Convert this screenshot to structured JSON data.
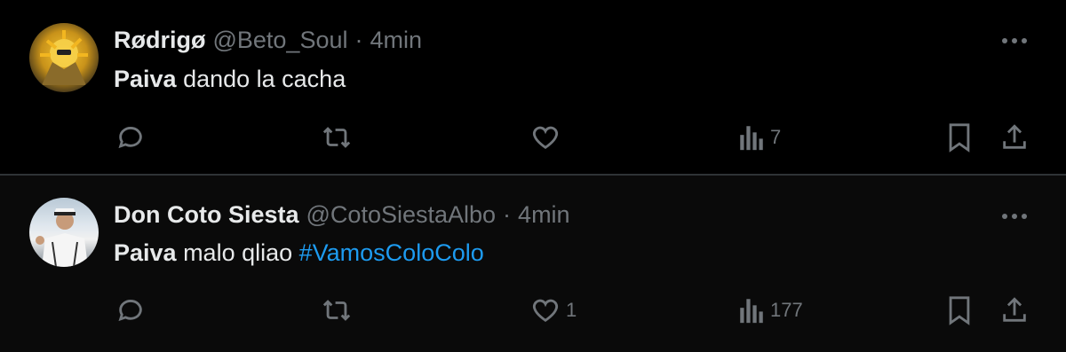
{
  "tweets": [
    {
      "display_name": "Rødrigø",
      "handle": "@Beto_Soul",
      "separator": "·",
      "time": "4min",
      "text_bold": "Paiva",
      "text_rest": " dando la cacha",
      "hashtag": "",
      "reply_count": "",
      "retweet_count": "",
      "like_count": "",
      "view_count": "7"
    },
    {
      "display_name": "Don Coto Siesta",
      "handle": "@CotoSiestaAlbo",
      "separator": "·",
      "time": "4min",
      "text_bold": "Paiva",
      "text_rest": " malo qliao ",
      "hashtag": "#VamosColoColo",
      "reply_count": "",
      "retweet_count": "",
      "like_count": "1",
      "view_count": "177"
    }
  ],
  "icons": {
    "reply": "reply-icon",
    "retweet": "retweet-icon",
    "like": "heart-icon",
    "views": "views-icon",
    "bookmark": "bookmark-icon",
    "share": "share-icon",
    "more": "more-icon"
  },
  "colors": {
    "background": "#000000",
    "text": "#e7e9ea",
    "muted": "#71767b",
    "hashtag": "#1d9bf0"
  }
}
